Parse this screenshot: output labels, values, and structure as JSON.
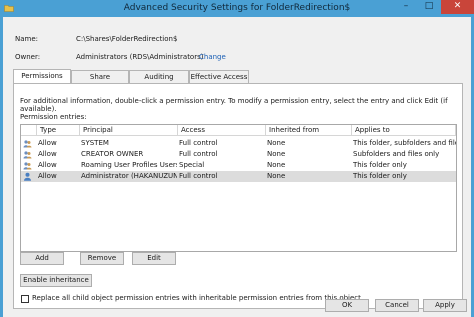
{
  "window": {
    "title": "Advanced Security Settings for FolderRedirection$",
    "minimize_glyph": "–",
    "maximize_glyph": "□",
    "close_glyph": "✕"
  },
  "info": {
    "name_label": "Name:",
    "name_value": "C:\\Shares\\FolderRedirection$",
    "owner_label": "Owner:",
    "owner_value": "Administrators (RDS\\Administrators)",
    "change_link": "Change"
  },
  "tabs": [
    {
      "label": "Permissions",
      "active": true
    },
    {
      "label": "Share",
      "active": false
    },
    {
      "label": "Auditing",
      "active": false
    },
    {
      "label": "Effective Access",
      "active": false
    }
  ],
  "permissions": {
    "intro": "For additional information, double-click a permission entry. To modify a permission entry, select the entry and click Edit (if available).",
    "entries_label": "Permission entries:",
    "columns": [
      "Type",
      "Principal",
      "Access",
      "Inherited from",
      "Applies to"
    ],
    "rows": [
      {
        "type": "Allow",
        "principal": "SYSTEM",
        "access": "Full control",
        "inherited": "None",
        "applies": "This folder, subfolders and files",
        "icon": "group-icon",
        "selected": false
      },
      {
        "type": "Allow",
        "principal": "CREATOR OWNER",
        "access": "Full control",
        "inherited": "None",
        "applies": "Subfolders and files only",
        "icon": "group-icon",
        "selected": false
      },
      {
        "type": "Allow",
        "principal": "Roaming User Profiles Users a...",
        "access": "Special",
        "inherited": "None",
        "applies": "This folder only",
        "icon": "group-icon",
        "selected": false
      },
      {
        "type": "Allow",
        "principal": "Administrator (HAKANUZUN...",
        "access": "Full control",
        "inherited": "None",
        "applies": "This folder only",
        "icon": "user-icon",
        "selected": true
      }
    ],
    "add_label": "Add",
    "remove_label": "Remove",
    "edit_label": "Edit",
    "enable_inheritance_label": "Enable inheritance",
    "replace_label": "Replace all child object permission entries with inheritable permission entries from this object",
    "replace_checked": false
  },
  "footer": {
    "ok_label": "OK",
    "cancel_label": "Cancel",
    "apply_label": "Apply"
  },
  "colors": {
    "titlebar": "#4aa0d4",
    "close_button": "#c9453a",
    "link": "#1b5fb4"
  }
}
